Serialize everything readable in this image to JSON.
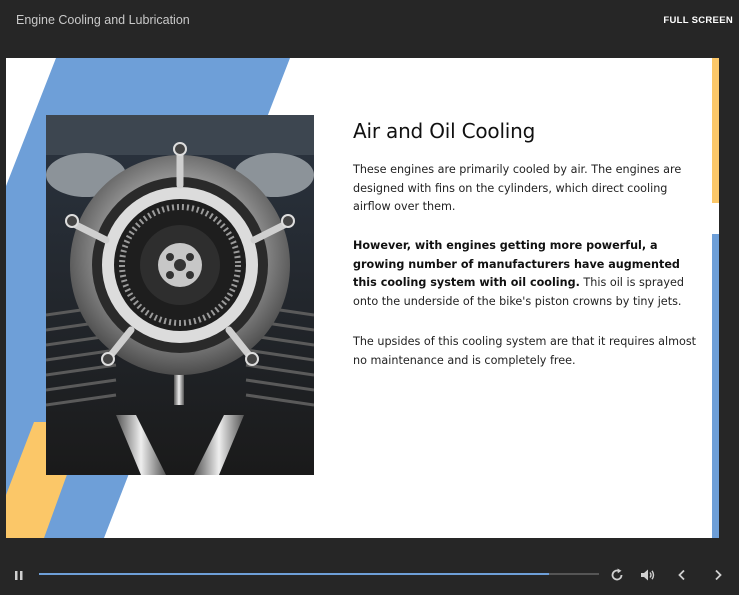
{
  "header": {
    "course_title": "Engine Cooling and Lubrication",
    "fullscreen_label": "FULL SCREEN"
  },
  "slide": {
    "heading": "Air and Oil Cooling",
    "paragraph1": "These engines are primarily cooled by air. The engines are designed with fins on the cylinders, which direct cooling airflow over them.",
    "paragraph2_bold": "However, with engines getting more powerful, a growing number of manufacturers have augmented this cooling system with oil cooling.",
    "paragraph2_rest": " This oil is sprayed onto the underside of the bike's piston crowns by tiny jets.",
    "paragraph3": "The upsides of this cooling system are that it requires almost no maintenance and is completely free.",
    "image_subject": "motorcycle engine air cleaner"
  },
  "player": {
    "progress_fraction": 0.91,
    "icons": [
      "pause-icon",
      "replay-icon",
      "volume-icon",
      "chevron-left-icon",
      "chevron-right-icon"
    ]
  },
  "colors": {
    "accent_blue": "#6e9fd8",
    "accent_yellow": "#fbc768",
    "background_dark": "#262626"
  }
}
